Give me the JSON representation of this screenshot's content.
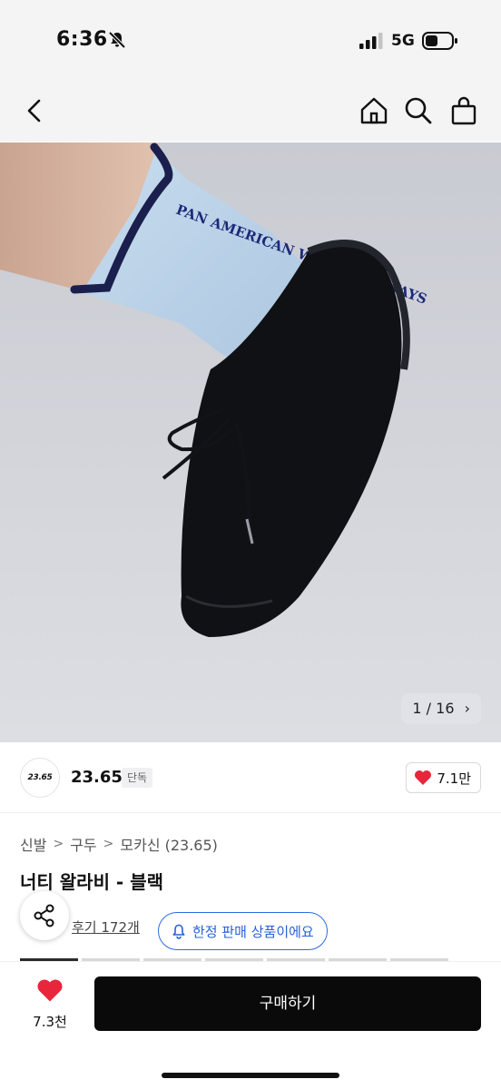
{
  "status_bar": {
    "time": "6:36",
    "network": "5G"
  },
  "nav": {
    "back_icon": "chevron-left-icon",
    "home_icon": "home-icon",
    "search_icon": "search-icon",
    "bag_icon": "shopping-bag-icon"
  },
  "hero": {
    "pager": "1 / 16",
    "sock_print": "PAN AMERICAN WORLD AIRWAYS"
  },
  "brand": {
    "logo_text": "23.65",
    "name": "23.65",
    "badge": "단독",
    "likes": "7.1만"
  },
  "breadcrumb": {
    "items": [
      "신발",
      "구두",
      "모카신 (23.65)"
    ],
    "separator": ">"
  },
  "product": {
    "title": "너티 왈라비 - 블랙"
  },
  "reviews": {
    "label": "후기 172개"
  },
  "limited": {
    "label": "한정 판매 상품이에요"
  },
  "bottom": {
    "wish_count": "7.3천",
    "buy_label": "구매하기"
  },
  "colors": {
    "accent_blue": "#2d6be0",
    "heart_red": "#e8263b",
    "buy_black": "#0a0a0a"
  }
}
